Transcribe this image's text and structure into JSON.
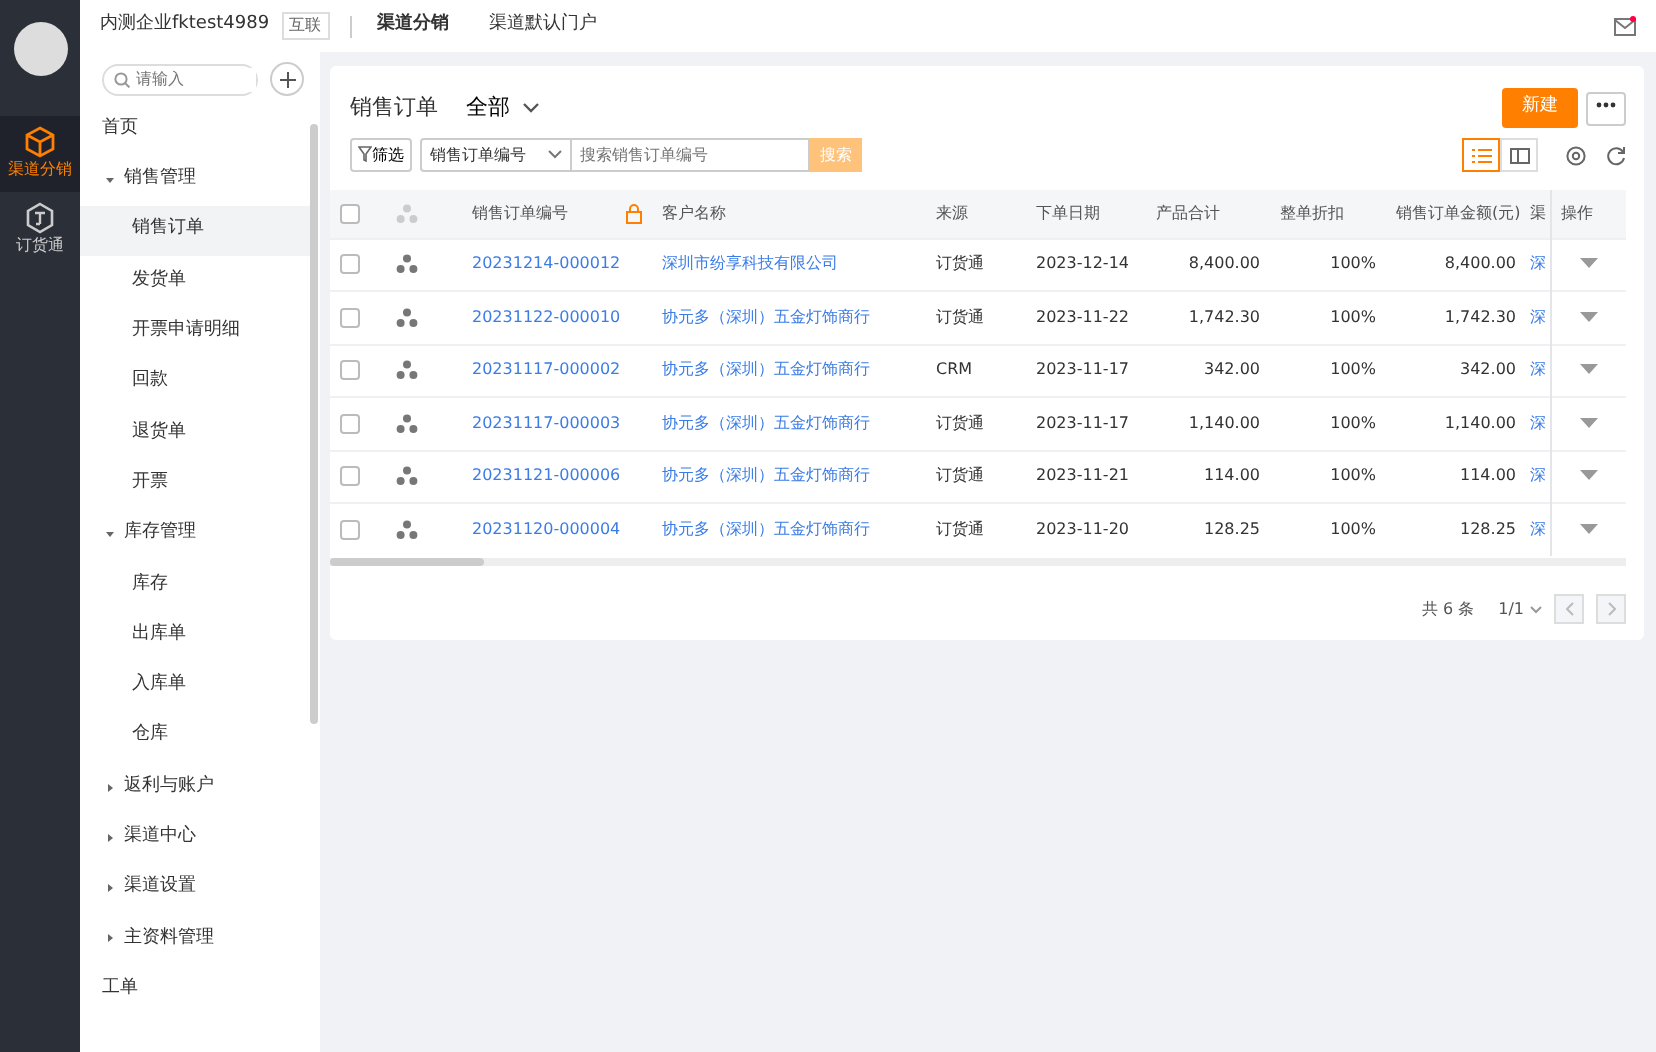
{
  "rail": {
    "items": [
      {
        "label": "渠道分销",
        "selected": true
      },
      {
        "label": "订货通",
        "selected": false
      }
    ]
  },
  "header": {
    "company": "内测企业fktest4989",
    "tag": "互联",
    "tabs": [
      {
        "label": "渠道分销",
        "selected": true
      },
      {
        "label": "渠道默认门户",
        "selected": false
      }
    ]
  },
  "sidebar": {
    "search": {
      "placeholder": "请输入"
    },
    "items": [
      {
        "label": "首页",
        "selected": false
      },
      {
        "label": "销售管理",
        "expanded": true,
        "children": [
          {
            "label": "销售订单",
            "selected": true
          },
          {
            "label": "发货单",
            "selected": false
          },
          {
            "label": "开票申请明细",
            "selected": false
          },
          {
            "label": "回款",
            "selected": false
          },
          {
            "label": "退货单",
            "selected": false
          },
          {
            "label": "开票",
            "selected": false
          }
        ]
      },
      {
        "label": "库存管理",
        "expanded": true,
        "children": [
          {
            "label": "库存",
            "selected": false
          },
          {
            "label": "出库单",
            "selected": false
          },
          {
            "label": "入库单",
            "selected": false
          },
          {
            "label": "仓库",
            "selected": false
          }
        ]
      },
      {
        "label": "返利与账户",
        "expanded": false
      },
      {
        "label": "渠道中心",
        "expanded": false
      },
      {
        "label": "渠道设置",
        "expanded": false
      },
      {
        "label": "主资料管理",
        "expanded": false
      },
      {
        "label": "工单",
        "selected": false
      }
    ]
  },
  "page": {
    "title": "销售订单",
    "scope": "全部",
    "new_button": "新建",
    "filter_button": "筛选",
    "search_field": "销售订单编号",
    "search": {
      "placeholder": "搜索销售订单编号"
    },
    "search_button": "搜索",
    "views": [
      {
        "kind": "list",
        "selected": true
      },
      {
        "kind": "card",
        "selected": false
      }
    ]
  },
  "table": {
    "all_checked": false,
    "columns": [
      "销售订单编号",
      "客户名称",
      "来源",
      "下单日期",
      "产品合计",
      "整单折扣",
      "销售订单金额(元)",
      "渠",
      "操作"
    ],
    "rows": [
      {
        "checked": false,
        "cells": [
          "20231214-000012",
          "深圳市纷享科技有限公司",
          "订货通",
          "2023-12-14",
          "8,400.00",
          "100%",
          "8,400.00",
          "深"
        ]
      },
      {
        "checked": false,
        "cells": [
          "20231122-000010",
          "协元多（深圳）五金灯饰商行",
          "订货通",
          "2023-11-22",
          "1,742.30",
          "100%",
          "1,742.30",
          "深"
        ]
      },
      {
        "checked": false,
        "cells": [
          "20231117-000002",
          "协元多（深圳）五金灯饰商行",
          "CRM",
          "2023-11-17",
          "342.00",
          "100%",
          "342.00",
          "深"
        ]
      },
      {
        "checked": false,
        "cells": [
          "20231117-000003",
          "协元多（深圳）五金灯饰商行",
          "订货通",
          "2023-11-17",
          "1,140.00",
          "100%",
          "1,140.00",
          "深"
        ]
      },
      {
        "checked": false,
        "cells": [
          "20231121-000006",
          "协元多（深圳）五金灯饰商行",
          "订货通",
          "2023-11-21",
          "114.00",
          "100%",
          "114.00",
          "深"
        ]
      },
      {
        "checked": false,
        "cells": [
          "20231120-000004",
          "协元多（深圳）五金灯饰商行",
          "订货通",
          "2023-11-20",
          "128.25",
          "100%",
          "128.25",
          "深"
        ]
      }
    ]
  },
  "pagination": {
    "total": "共 6 条",
    "page": "1/1"
  }
}
